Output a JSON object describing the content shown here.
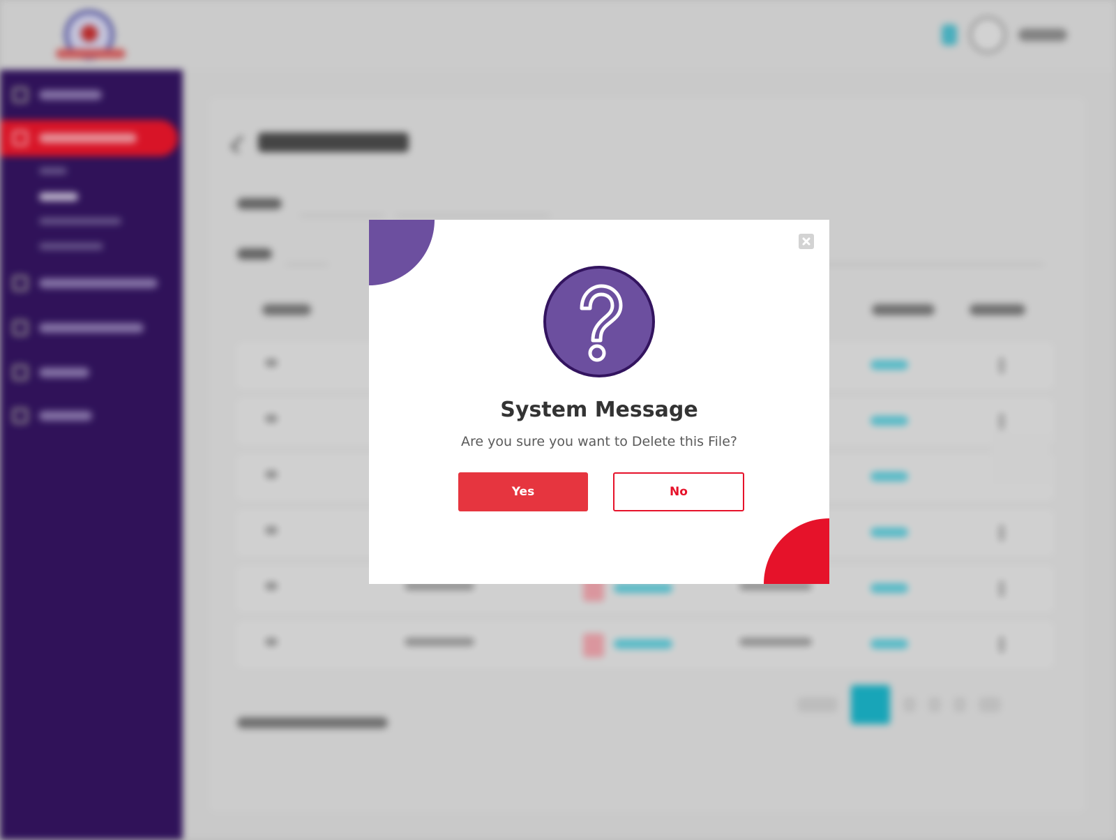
{
  "dialog": {
    "title": "System Message",
    "message": "Are you sure you want to Delete this File?",
    "yes_label": "Yes",
    "no_label": "No",
    "icon": "question-circle-icon",
    "close_icon": "close-icon"
  },
  "colors": {
    "brand_purple": "#33145f",
    "accent_purple": "#6c4f9f",
    "accent_red": "#e6122a",
    "button_red": "#e6353f",
    "teal": "#1ab0c4"
  }
}
